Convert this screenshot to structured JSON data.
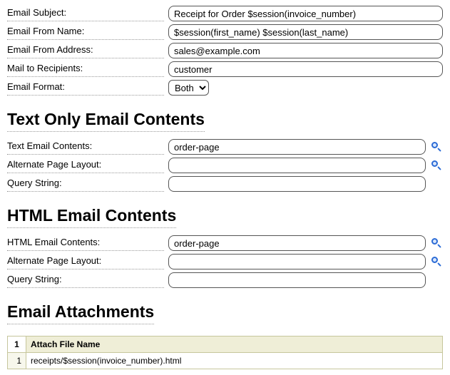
{
  "fields": {
    "subject": {
      "label": "Email Subject:",
      "value": "Receipt for Order $session(invoice_number)"
    },
    "fromName": {
      "label": "Email From Name:",
      "value": "$session(first_name) $session(last_name)"
    },
    "fromAddress": {
      "label": "Email From Address:",
      "value": "sales@example.com"
    },
    "recipients": {
      "label": "Mail to Recipients:",
      "value": "customer"
    },
    "format": {
      "label": "Email Format:",
      "value": "Both"
    }
  },
  "sections": {
    "textOnly": {
      "heading": "Text Only Email Contents",
      "contents": {
        "label": "Text Email Contents:",
        "value": "order-page"
      },
      "altLayout": {
        "label": "Alternate Page Layout:",
        "value": ""
      },
      "query": {
        "label": "Query String:",
        "value": ""
      }
    },
    "html": {
      "heading": "HTML Email Contents",
      "contents": {
        "label": "HTML Email Contents:",
        "value": "order-page"
      },
      "altLayout": {
        "label": "Alternate Page Layout:",
        "value": ""
      },
      "query": {
        "label": "Query String:",
        "value": ""
      }
    },
    "attachments": {
      "heading": "Email Attachments",
      "columnIndex": "1",
      "columnName": "Attach File Name",
      "rows": [
        {
          "index": "1",
          "name": "receipts/$session(invoice_number).html"
        }
      ]
    }
  }
}
